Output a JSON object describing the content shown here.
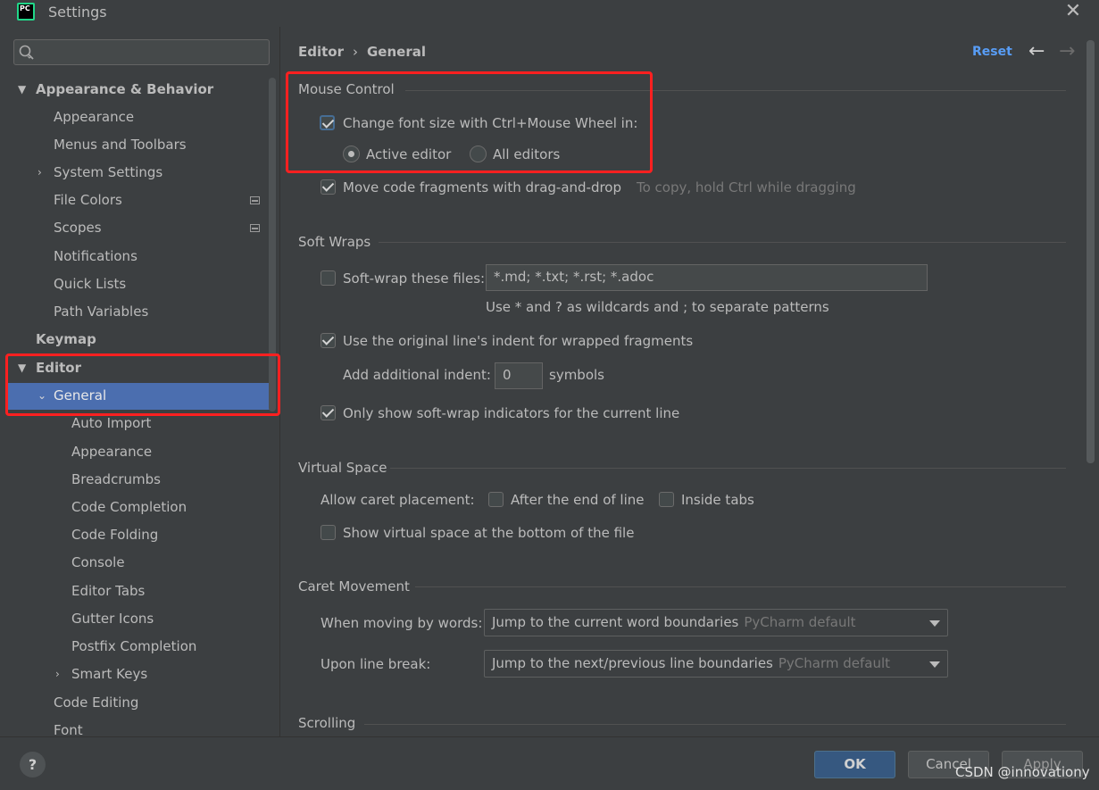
{
  "window": {
    "title": "Settings",
    "logo_text": "PC"
  },
  "search": {
    "placeholder": ""
  },
  "tree": {
    "appearance_behavior": "Appearance & Behavior",
    "appearance": "Appearance",
    "menus_toolbars": "Menus and Toolbars",
    "system_settings": "System Settings",
    "file_colors": "File Colors",
    "scopes": "Scopes",
    "notifications": "Notifications",
    "quick_lists": "Quick Lists",
    "path_variables": "Path Variables",
    "keymap": "Keymap",
    "editor": "Editor",
    "general": "General",
    "auto_import": "Auto Import",
    "gen_appearance": "Appearance",
    "breadcrumbs": "Breadcrumbs",
    "code_completion": "Code Completion",
    "code_folding": "Code Folding",
    "console": "Console",
    "editor_tabs": "Editor Tabs",
    "gutter_icons": "Gutter Icons",
    "postfix_completion": "Postfix Completion",
    "smart_keys": "Smart Keys",
    "code_editing": "Code Editing",
    "font": "Font"
  },
  "header": {
    "crumb_parent": "Editor",
    "crumb_separator": "›",
    "crumb_current": "General",
    "reset": "Reset",
    "back": "←",
    "forward": "→"
  },
  "mouse_control": {
    "title": "Mouse Control",
    "change_font_size": "Change font size with Ctrl+Mouse Wheel in:",
    "change_font_size_checked": true,
    "active_editor": "Active editor",
    "all_editors": "All editors",
    "selected_scope": "Active editor",
    "move_fragments": "Move code fragments with drag-and-drop",
    "move_fragments_checked": true,
    "move_hint": "To copy, hold Ctrl while dragging"
  },
  "soft_wraps": {
    "title": "Soft Wraps",
    "soft_wrap_files": "Soft-wrap these files:",
    "soft_wrap_checked": false,
    "patterns": "*.md; *.txt; *.rst; *.adoc",
    "patterns_hint": "Use * and ? as wildcards and ; to separate patterns",
    "use_indent": "Use the original line's indent for wrapped fragments",
    "use_indent_checked": true,
    "additional_indent": "Add additional indent:",
    "indent_value": "0",
    "symbols": "symbols",
    "indicators": "Only show soft-wrap indicators for the current line",
    "indicators_checked": true
  },
  "virtual_space": {
    "title": "Virtual Space",
    "allow_caret": "Allow caret placement:",
    "after_end": "After the end of line",
    "after_end_checked": false,
    "inside_tabs": "Inside tabs",
    "inside_tabs_checked": false,
    "show_virtual": "Show virtual space at the bottom of the file",
    "show_virtual_checked": false
  },
  "caret_movement": {
    "title": "Caret Movement",
    "moving_words": "When moving by words:",
    "moving_words_value": "Jump to the current word boundaries",
    "moving_words_hint": "PyCharm default",
    "line_break": "Upon line break:",
    "line_break_value": "Jump to the next/previous line boundaries",
    "line_break_hint": "PyCharm default"
  },
  "scrolling": {
    "title": "Scrolling"
  },
  "footer": {
    "help": "?",
    "ok": "OK",
    "cancel": "Cancel",
    "apply": "Apply",
    "watermark": "CSDN @innovationy"
  },
  "colors": {
    "background": "#3c3f41",
    "selection": "#4b6eaf",
    "link": "#589df6",
    "highlight_box": "#ff2020",
    "primary_button": "#365880"
  }
}
